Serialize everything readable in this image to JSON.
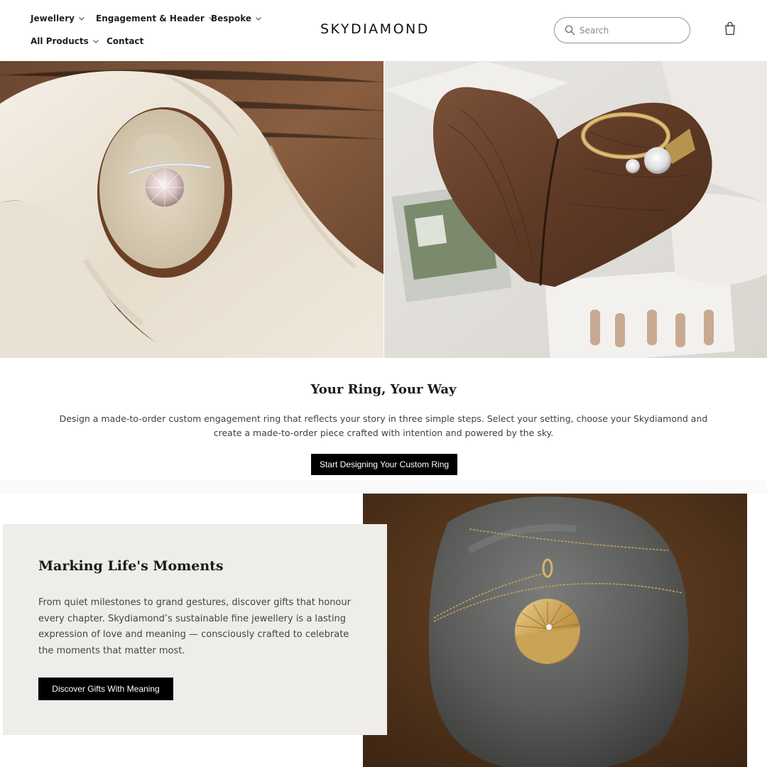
{
  "header": {
    "nav": [
      {
        "label": "Jewellery",
        "has_dropdown": true
      },
      {
        "label": "Engagement & Header",
        "has_dropdown": true
      },
      {
        "label": "Bespoke",
        "has_dropdown": true
      },
      {
        "label": "All Products",
        "has_dropdown": true
      },
      {
        "label": "Contact",
        "has_dropdown": false
      }
    ],
    "logo": "SKYDIAMOND",
    "search_placeholder": "Search",
    "search_value": "",
    "icons": {
      "search": "search-icon",
      "cart": "shopping-bag-icon",
      "dropdown": "chevron-down-icon"
    }
  },
  "hero": {
    "left_image": "solitaire-ring-in-box-on-silk",
    "right_image": "gold-ring-on-wooden-heart-box"
  },
  "custom_ring": {
    "title": "Your Ring, Your Way",
    "description": "Design a made-to-order custom engagement ring that reflects your story in three simple steps. Select your setting, choose your Skydiamond and create a made-to-order piece crafted with intention and powered by the sky.",
    "button_label": "Start Designing Your Custom Ring"
  },
  "moments": {
    "title": "Marking Life's Moments",
    "description": "From quiet milestones to grand gestures, discover gifts that honour every chapter. Skydiamond’s sustainable fine jewellery is a lasting expression of love and meaning — consciously crafted to celebrate the moments that matter most.",
    "button_label": "Discover Gifts With Meaning",
    "image": "gold-sunburst-pendant-on-stone"
  },
  "colors": {
    "button_bg": "#000000",
    "button_text": "#ffffff",
    "card_bg": "#efedea",
    "text_primary": "#1a1a1a",
    "text_secondary": "#444444"
  }
}
